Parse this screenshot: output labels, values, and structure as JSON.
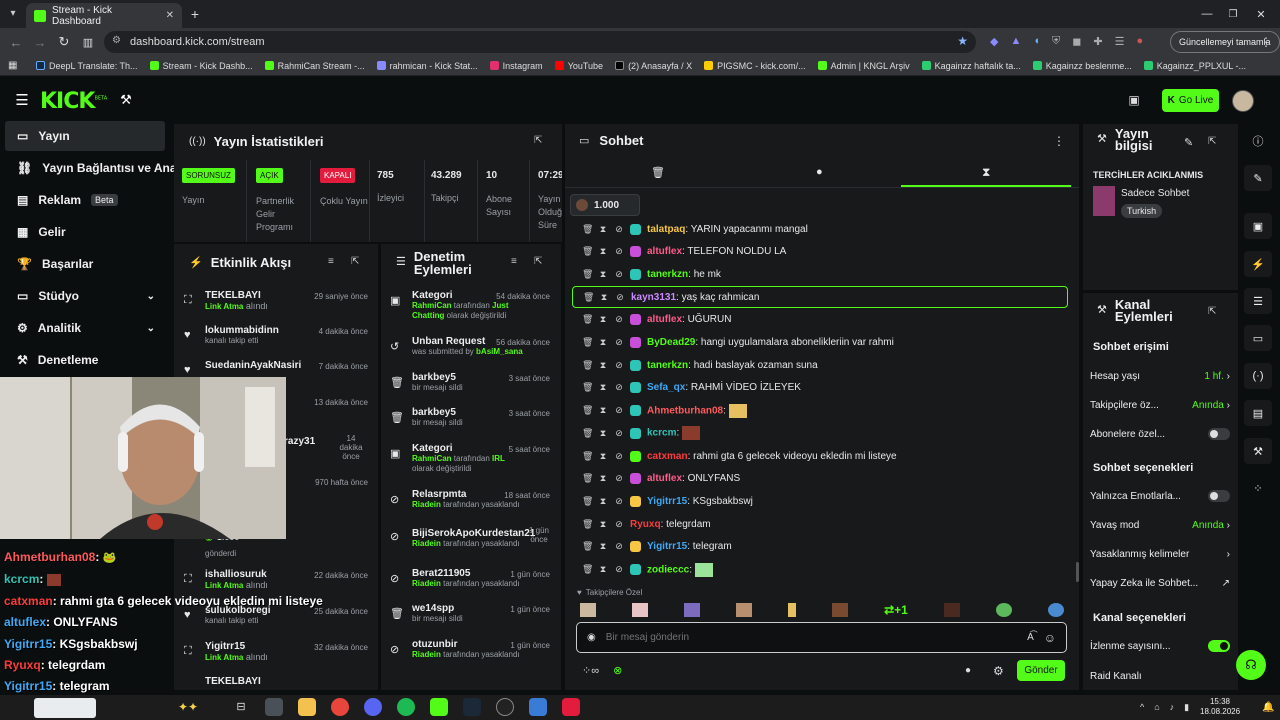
{
  "browser": {
    "tab_title": "Stream - Kick Dashboard",
    "url": "dashboard.kick.com/stream",
    "update_label": "Güncellemeyi tamamla",
    "bookmarks": [
      {
        "label": "DeepL Translate: Th...",
        "color": "#0f2b46"
      },
      {
        "label": "Stream - Kick Dashb...",
        "color": "#53fc18"
      },
      {
        "label": "RahmiCan Stream -...",
        "color": "#53fc18"
      },
      {
        "label": "rahmican - Kick Stat...",
        "color": "#8a8aff"
      },
      {
        "label": "Instagram",
        "color": "#e1306c"
      },
      {
        "label": "YouTube",
        "color": "#ff0000"
      },
      {
        "label": "(2) Anasayfa / X",
        "color": "#000000"
      },
      {
        "label": "PIGSMC - kick.com/...",
        "color": "#ffcc00"
      },
      {
        "label": "Admin | KNGL Arşiv",
        "color": "#53fc18"
      },
      {
        "label": "Kagainzz haftalık ta...",
        "color": "#2ecc71"
      },
      {
        "label": "Kagainzz beslenme...",
        "color": "#2ecc71"
      },
      {
        "label": "Kagainzz_PPLXUL -...",
        "color": "#2ecc71"
      }
    ]
  },
  "header": {
    "logo": "KICK",
    "logo_sup": "BETA",
    "go_live": "Go Live"
  },
  "sidebar": {
    "items": [
      {
        "label": "Yayın",
        "icon": "broadcast-icon"
      },
      {
        "label": "Yayın Bağlantısı ve Anahtarı",
        "icon": "link-icon"
      },
      {
        "label": "Reklam",
        "icon": "ad-icon",
        "badge": "Beta"
      },
      {
        "label": "Gelir",
        "icon": "wallet-icon"
      },
      {
        "label": "Başarılar",
        "icon": "trophy-icon"
      },
      {
        "label": "Stüdyo",
        "icon": "studio-icon"
      },
      {
        "label": "Analitik",
        "icon": "chart-icon"
      },
      {
        "label": "Denetleme",
        "icon": "gavel-icon"
      }
    ]
  },
  "stats": {
    "title": "Yayın İstatistikleri",
    "items": [
      {
        "value": "SORUNSUZ",
        "label": "Yayın",
        "style": "green"
      },
      {
        "value": "AÇIK",
        "label": "Partnerlik Gelir Programı",
        "style": "green"
      },
      {
        "value": "KAPALI",
        "label": "Çoklu Yayın",
        "style": "red"
      },
      {
        "value": "785",
        "label": "İzleyici",
        "style": "plain"
      },
      {
        "value": "43.289",
        "label": "Takipçi",
        "style": "plain"
      },
      {
        "value": "10",
        "label": "Abone Sayısı",
        "style": "plain"
      },
      {
        "value": "07:29",
        "label": "Yayın Olduğu Süre",
        "style": "plain"
      }
    ]
  },
  "feed": {
    "title": "Etkinlik Akışı",
    "rows": [
      {
        "name": "TEKELBAYI",
        "sub": "Link Atma",
        "sub2": " alındı",
        "time": "29 saniye önce"
      },
      {
        "name": "lokummabidinn",
        "sub": "",
        "sub2": "kanalı takip etti",
        "time": "4 dakika önce"
      },
      {
        "name": "SuedaninAyakNasiri",
        "sub": "",
        "sub2": "",
        "time": "7 dakika önce"
      },
      {
        "name": "",
        "sub": "",
        "sub2": "",
        "time": "13 dakika önce"
      },
      {
        "name": "razy31",
        "sub": "",
        "sub2": "",
        "time": "14 dakika önce"
      },
      {
        "name": "",
        "sub": "",
        "sub2": "",
        "time": "970 hafta önce"
      },
      {
        "name": "",
        "sub": "",
        "sub2": "gönderdi",
        "time": ""
      },
      {
        "name": "ishalliosuruk",
        "sub": "Link Atma",
        "sub2": " alındı",
        "time": "22 dakika önce"
      },
      {
        "name": "sulukolboregi",
        "sub": "",
        "sub2": "kanalı takip etti",
        "time": "25 dakika önce"
      },
      {
        "name": "Yigitrr15",
        "sub": "Link Atma",
        "sub2": " alındı",
        "time": "32 dakika önce"
      },
      {
        "name": "TEKELBAYI",
        "sub": "",
        "sub2": "",
        "time": ""
      }
    ],
    "gift_amount": "1.000"
  },
  "mod": {
    "title": "Denetim Eylemleri",
    "rows": [
      {
        "name": "Kategori",
        "sub_a": "RahmiCan",
        "sub_b": " tarafından ",
        "sub_c": "Just Chatting",
        "sub_d": " olarak değiştirildi",
        "time": "54 dakika önce"
      },
      {
        "name": "Unban Request",
        "sub_a": "",
        "sub_b": "was submitted by ",
        "sub_c": "bAsiM_sana",
        "sub_d": "",
        "time": "56 dakika önce"
      },
      {
        "name": "barkbey5",
        "sub_a": "",
        "sub_b": "bir mesajı sildi",
        "sub_c": "",
        "sub_d": "",
        "time": "3 saat önce"
      },
      {
        "name": "barkbey5",
        "sub_a": "",
        "sub_b": "bir mesajı sildi",
        "sub_c": "",
        "sub_d": "",
        "time": "3 saat önce"
      },
      {
        "name": "Kategori",
        "sub_a": "RahmiCan",
        "sub_b": " tarafından ",
        "sub_c": "IRL",
        "sub_d": " olarak değiştirildi",
        "time": "5 saat önce"
      },
      {
        "name": "Relasrpmta",
        "sub_a": "Riadein",
        "sub_b": " tarafından yasaklandı",
        "sub_c": "",
        "sub_d": "",
        "time": "18 saat önce"
      },
      {
        "name": "BijiSerokApoKurdestan21",
        "sub_a": "Riadein",
        "sub_b": " tarafından yasaklandı",
        "sub_c": "",
        "sub_d": "",
        "time": "1 gün önce"
      },
      {
        "name": "Berat211905",
        "sub_a": "Riadein",
        "sub_b": " tarafından yasaklandı",
        "sub_c": "",
        "sub_d": "",
        "time": "1 gün önce"
      },
      {
        "name": "we14spp",
        "sub_a": "",
        "sub_b": "bir mesajı sildi",
        "sub_c": "",
        "sub_d": "",
        "time": "1 gün önce"
      },
      {
        "name": "otuzunbir",
        "sub_a": "Riadein",
        "sub_b": " tarafından yasaklandı",
        "sub_c": "",
        "sub_d": "",
        "time": "1 gün önce"
      }
    ]
  },
  "chat": {
    "title": "Sohbet",
    "pinned_amount": "1.000",
    "followers_only": "Takipçilere Özel",
    "placeholder": "Bir mesaj gönderin",
    "send": "Gönder",
    "messages": [
      {
        "user": "talatpaq",
        "color": "#f6c744",
        "text": "YARIN yapacanmı mangal",
        "badge": "#2ec4b6"
      },
      {
        "user": "altuflex",
        "color": "#ff5a8a",
        "text": "TELEFON NOLDU LA",
        "badge": "#c84fd8"
      },
      {
        "user": "tanerkzn",
        "color": "#53fc18",
        "text": "he mk",
        "badge": "#2ec4b6"
      },
      {
        "user": "kayn3131",
        "color": "#c98bff",
        "text": "yaş kaç rahmican",
        "badge": "",
        "highlight": true
      },
      {
        "user": "altuflex",
        "color": "#ff5a8a",
        "text": "UĞURUN",
        "badge": "#c84fd8"
      },
      {
        "user": "ByDead29",
        "color": "#53fc18",
        "text": "hangi uygulamalara abonelikleriin var rahmi",
        "badge": "#c84fd8"
      },
      {
        "user": "tanerkzn",
        "color": "#53fc18",
        "text": "hadi baslayak ozaman suna",
        "badge": "#2ec4b6"
      },
      {
        "user": "Sefa_qx",
        "color": "#3fa9f5",
        "text": "RAHMİ VİDEO İZLEYEK",
        "badge": "#2ec4b6"
      },
      {
        "user": "Ahmetburhan08",
        "color": "#ff5a5a",
        "text": "",
        "badge": "#2ec4b6",
        "emote": true
      },
      {
        "user": "kcrcm",
        "color": "#2ec4b6",
        "text": "",
        "badge": "#2ec4b6",
        "emote": true
      },
      {
        "user": "catxman",
        "color": "#ff3b3b",
        "text": "rahmi gta 6 gelecek videoyu ekledin mi listeye",
        "badge": "#53fc18"
      },
      {
        "user": "altuflex",
        "color": "#ff5a8a",
        "text": "ONLYFANS",
        "badge": "#c84fd8"
      },
      {
        "user": "Yigitrr15",
        "color": "#3fa9f5",
        "text": "KSgsbakbswj",
        "badge": "#f6c744"
      },
      {
        "user": "Ryuxq",
        "color": "#ff3b3b",
        "text": "telegrdam",
        "badge": ""
      },
      {
        "user": "Yigitrr15",
        "color": "#3fa9f5",
        "text": "telegram",
        "badge": "#f6c744"
      },
      {
        "user": "zodieccc",
        "color": "#53fc18",
        "text": "",
        "badge": "#2ec4b6",
        "emote": true
      }
    ]
  },
  "info": {
    "title": "Yayın bilgisi",
    "stream_title": "TERCİHLER ACIKLANMIS",
    "category": "Sadece Sohbet",
    "language": "Turkish"
  },
  "channel": {
    "title": "Kanal Eylemleri",
    "chat_access": "Sohbet erişimi",
    "account_age": "Hesap yaşı",
    "account_age_val": "1 hf.",
    "followers": "Takipçilere öz...",
    "followers_val": "Anında",
    "subs": "Abonelere özel...",
    "chat_options": "Sohbet seçenekleri",
    "emotes_only": "Yalnızca Emotlarla...",
    "slow_mode": "Yavaş mod",
    "slow_mode_val": "Anında",
    "banned_words": "Yasaklanmış kelimeler",
    "ai": "Yapay Zeka ile Sohbet...",
    "channel_options": "Kanal seçenekleri",
    "view_count": "İzlenme sayısını...",
    "raid": "Raid Kanalı"
  },
  "overlay": {
    "lines": [
      {
        "user": "Ahmetburhan08",
        "color": "#ff5a5a",
        "text": ":"
      },
      {
        "user": "kcrcm",
        "color": "#2ec4b6",
        "text": ":"
      },
      {
        "user": "catxman",
        "color": "#ff3b3b",
        "text": ": rahmi gta 6 gelecek videoyu ekledin mi listeye"
      },
      {
        "user": "altuflex",
        "color": "#3fa9f5",
        "text": ": ONLYFANS"
      },
      {
        "user": "Yigitrr15",
        "color": "#3fa9f5",
        "text": ": KSgsbakbswj"
      },
      {
        "user": "Ryuxq",
        "color": "#ff3b3b",
        "text": ": telegrdam"
      },
      {
        "user": "Yigitrr15",
        "color": "#3fa9f5",
        "text": ": telegram"
      }
    ]
  },
  "taskbar": {
    "time": "15:38",
    "date": "18.08.2026"
  }
}
